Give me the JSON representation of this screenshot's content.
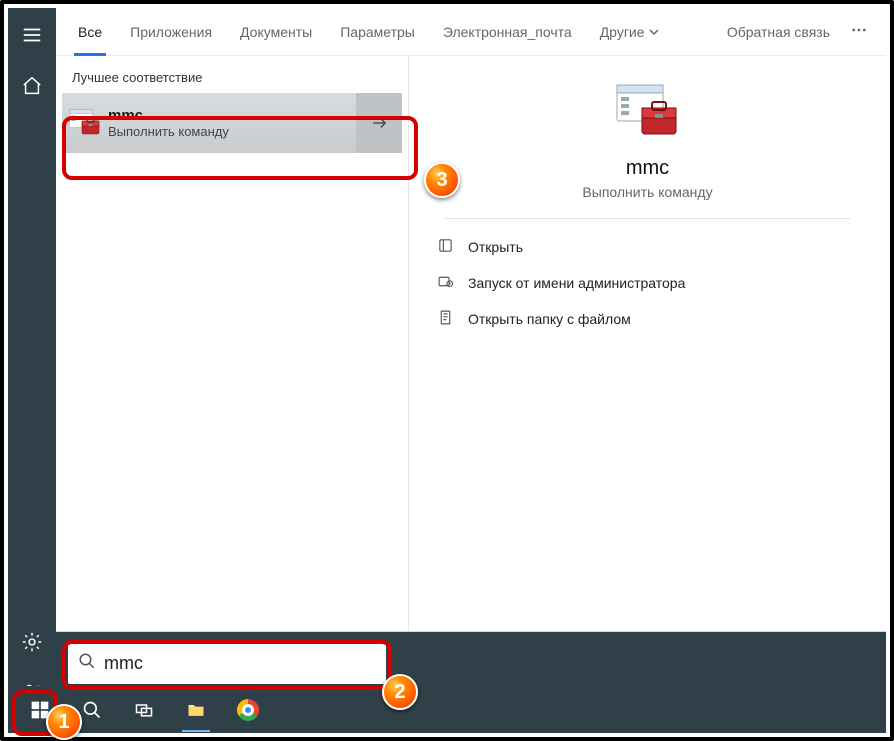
{
  "tabs": {
    "items": [
      {
        "label": "Все",
        "active": true
      },
      {
        "label": "Приложения",
        "active": false
      },
      {
        "label": "Документы",
        "active": false
      },
      {
        "label": "Параметры",
        "active": false
      },
      {
        "label": "Электронная_почта",
        "active": false
      },
      {
        "label": "Другие",
        "active": false,
        "dropdown": true
      }
    ],
    "feedback": "Обратная связь"
  },
  "results": {
    "section_label": "Лучшее соответствие",
    "top": {
      "name": "mmc",
      "subtitle": "Выполнить команду"
    }
  },
  "detail": {
    "title": "mmc",
    "subtitle": "Выполнить команду",
    "actions": [
      {
        "icon": "open-icon",
        "label": "Открыть"
      },
      {
        "icon": "admin-icon",
        "label": "Запуск от имени администратора"
      },
      {
        "icon": "folder-open-icon",
        "label": "Открыть папку с файлом"
      }
    ]
  },
  "search": {
    "query": "mmc"
  },
  "annotations": {
    "badge1": "1",
    "badge2": "2",
    "badge3": "3"
  }
}
